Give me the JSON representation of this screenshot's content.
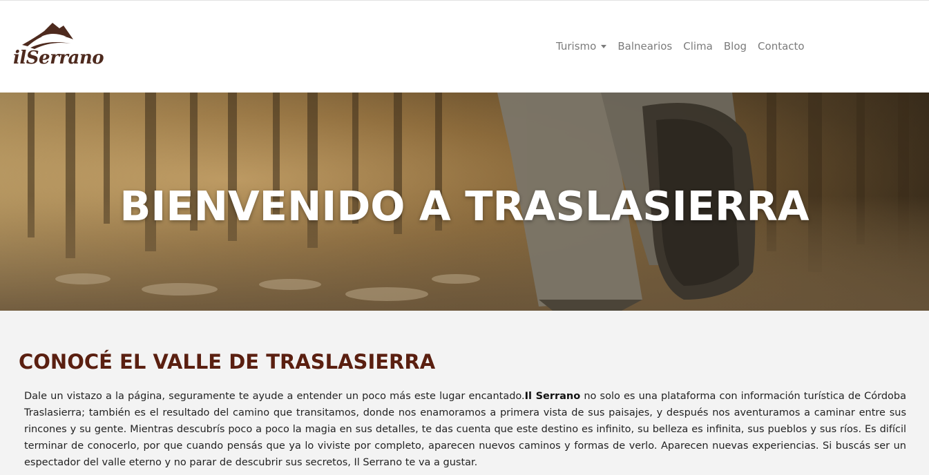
{
  "brand": {
    "name": "ilSerrano",
    "logo_color": "#4e2a1e"
  },
  "nav": {
    "items": [
      {
        "label": "Turismo",
        "dropdown": true
      },
      {
        "label": "Balnearios"
      },
      {
        "label": "Clima"
      },
      {
        "label": "Blog"
      },
      {
        "label": "Contacto"
      }
    ],
    "link_color": "#7b7b7b"
  },
  "hero": {
    "title": "BIENVENIDO A TRASLASIERRA"
  },
  "section": {
    "title": "CONOCÉ EL VALLE DE TRASLASIERRA",
    "title_color": "#5a1f10",
    "intro_before": "Dale un vistazo a la página, seguramente te ayude a entender un poco más este lugar encantado.",
    "intro_bold": "Il Serrano",
    "intro_after": " no solo es una plataforma con información turística de Córdoba Traslasierra; también es el resultado del camino que transitamos, donde nos enamoramos a primera vista de sus paisajes, y después nos aventuramos a caminar entre sus rincones y su gente. Mientras descubrís poco a poco la magia en sus detalles, te das cuenta que este destino es infinito, su belleza es infinita, sus pueblos y sus ríos. Es difícil terminar de conocerlo, por que cuando pensás que ya lo viviste por completo, aparecen nuevos caminos y formas de verlo. Aparecen nuevas experiencias. Si buscás ser un espectador del valle eterno y no parar de descubrir sus secretos, Il Serrano te va a gustar."
  }
}
